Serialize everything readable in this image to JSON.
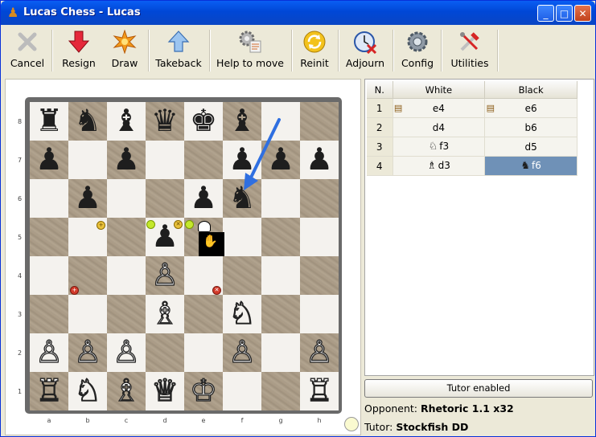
{
  "window": {
    "title": "Lucas Chess - Lucas"
  },
  "toolbar": {
    "buttons": [
      {
        "id": "cancel",
        "label": "Cancel"
      },
      {
        "id": "resign",
        "label": "Resign"
      },
      {
        "id": "draw",
        "label": "Draw"
      },
      {
        "id": "takeback",
        "label": "Takeback"
      },
      {
        "id": "help",
        "label": "Help to move"
      },
      {
        "id": "reinit",
        "label": "Reinit"
      },
      {
        "id": "adjourn",
        "label": "Adjourn"
      },
      {
        "id": "config",
        "label": "Config"
      },
      {
        "id": "utilities",
        "label": "Utilities"
      }
    ]
  },
  "board": {
    "ranks": [
      "8",
      "7",
      "6",
      "5",
      "4",
      "3",
      "2",
      "1"
    ],
    "files": [
      "a",
      "b",
      "c",
      "d",
      "e",
      "f",
      "g",
      "h"
    ],
    "position": [
      [
        "♜",
        "♞",
        "♝",
        "♛",
        "♚",
        "♝",
        "",
        ""
      ],
      [
        "♟",
        "",
        "♟",
        "",
        "",
        "♟",
        "♟",
        "♟"
      ],
      [
        "",
        "♟",
        "",
        "",
        "♟",
        "♞",
        "",
        ""
      ],
      [
        "",
        "",
        "",
        "♟",
        "",
        "",
        "",
        ""
      ],
      [
        "",
        "",
        "",
        "♙",
        "",
        "",
        "",
        ""
      ],
      [
        "",
        "",
        "",
        "♗",
        "",
        "♘",
        "",
        ""
      ],
      [
        "♙",
        "♙",
        "♙",
        "",
        "",
        "♙",
        "",
        "♙"
      ],
      [
        "♖",
        "♘",
        "♗",
        "♕",
        "♔",
        "",
        "",
        "♖"
      ]
    ],
    "status_color": "#fafad0"
  },
  "moves": {
    "headers": {
      "n": "N.",
      "white": "White",
      "black": "Black"
    },
    "rows": [
      {
        "n": "1",
        "white": "e4",
        "black": "e6",
        "white_icon": "book-icon",
        "black_icon": "book-icon"
      },
      {
        "n": "2",
        "white": "d4",
        "black": "b6"
      },
      {
        "n": "3",
        "white": "f3",
        "black": "d5",
        "white_piece": "♘"
      },
      {
        "n": "4",
        "white": "d3",
        "black": "f6",
        "white_piece": "♗",
        "black_piece": "♞"
      }
    ]
  },
  "tutor_button": "Tutor enabled",
  "opponent": {
    "label": "Opponent:",
    "value": "Rhetoric 1.1 x32"
  },
  "tutor": {
    "label": "Tutor:",
    "value": "Stockfish DD"
  }
}
